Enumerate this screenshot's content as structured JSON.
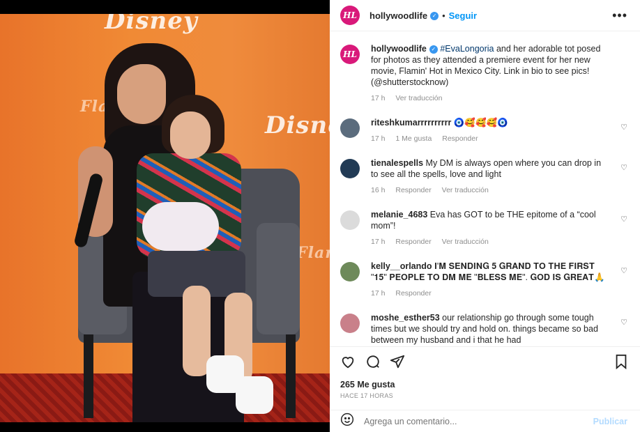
{
  "post": {
    "username": "hollywoodlife",
    "follow_label": "Seguir",
    "more_label": "•••",
    "logo_text": "HL",
    "backdrop_logos": [
      "Disney",
      "Disney",
      "Flamin'",
      "Flamin'"
    ]
  },
  "caption": {
    "username": "hollywoodlife",
    "mention": "#EvaLongoria",
    "text": " and her adorable tot posed for photos as they attended a premiere event for her new movie, Flamin' Hot in Mexico City. Link in bio to see pics! ",
    "credit": "(@shutterstocknow)",
    "time": "17 h",
    "translate": "Ver traducción"
  },
  "comments": [
    {
      "username": "riteshkumarrrrrrrrrr",
      "text": "🧿🥰🥰🥰🧿",
      "time": "17 h",
      "likes": "1 Me gusta",
      "reply": "Responder",
      "translate": "",
      "avatar_color": "#5b6c7d"
    },
    {
      "username": "tienalespells",
      "text": "My DM is always open where you can drop in to see all the spells, love and light",
      "time": "16 h",
      "likes": "",
      "reply": "Responder",
      "translate": "Ver traducción",
      "avatar_color": "#223b55"
    },
    {
      "username": "melanie_4683",
      "text": "Eva has GOT to be THE epitome of a “cool mom”!",
      "time": "17 h",
      "likes": "",
      "reply": "Responder",
      "translate": "Ver traducción",
      "avatar_color": "#dbdbdb"
    },
    {
      "username": "kelly__orlando",
      "text": "𝐈'𝐌 𝐒𝐄𝐍𝐃𝐈𝐍𝐆 𝟓 𝐆𝐑𝐀𝐍𝐃 𝐓𝐎 𝐓𝐇𝐄 𝐅𝐈𝐑𝐒𝐓 \"𝟏𝟓\" 𝐏𝐄𝐎𝐏𝐋𝐄 𝐓𝐎 𝐃𝐌 𝐌𝐄 \"𝐁𝐋𝐄𝐒𝐒 𝐌𝐄\". 𝐆𝐎𝐃 𝐈𝐒 𝐆𝐑𝐄𝐀𝐓🙏",
      "time": "17 h",
      "likes": "",
      "reply": "Responder",
      "translate": "",
      "avatar_color": "#6e8a5a"
    },
    {
      "username": "moshe_esther53",
      "text": "our relationship go through some tough times but we should try and hold on. things became so bad between my husband and i that he had",
      "time": "",
      "likes": "",
      "reply": "",
      "translate": "",
      "avatar_color": "#c9808a"
    }
  ],
  "footer": {
    "likes": "265 Me gusta",
    "ago": "HACE 17 HORAS",
    "comment_placeholder": "Agrega un comentario...",
    "publish_label": "Publicar"
  }
}
